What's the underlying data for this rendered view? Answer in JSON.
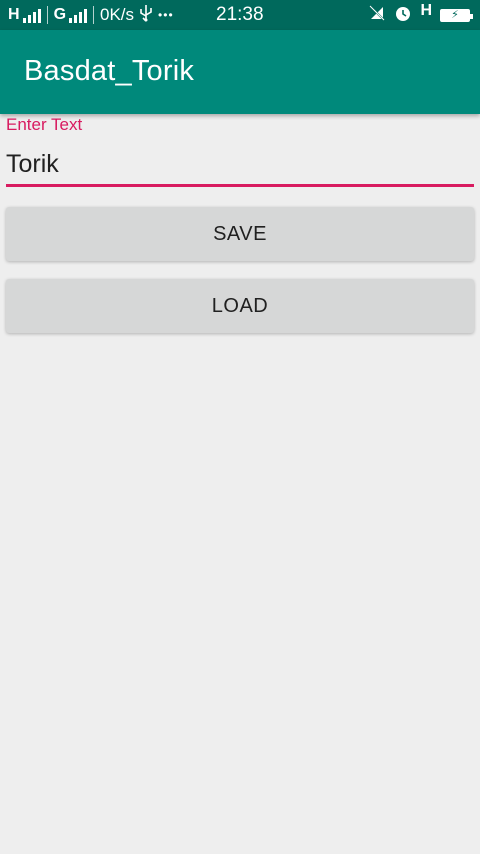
{
  "status_bar": {
    "sim1_label": "H",
    "sim2_label": "G",
    "speed": "0K/s",
    "usb_icon": "usb-icon",
    "more_dots": "•••",
    "time": "21:38",
    "mute_icon": "vibrate-off-icon",
    "alarm_icon": "alarm-icon",
    "network_type": "H",
    "battery_icon": "battery-charging-icon"
  },
  "app_bar": {
    "title": "Basdat_Torik",
    "color": "#00897b"
  },
  "form": {
    "label": "Enter Text",
    "value": "Torik",
    "accent_color": "#d81b60"
  },
  "buttons": {
    "save_label": "SAVE",
    "load_label": "LOAD"
  }
}
